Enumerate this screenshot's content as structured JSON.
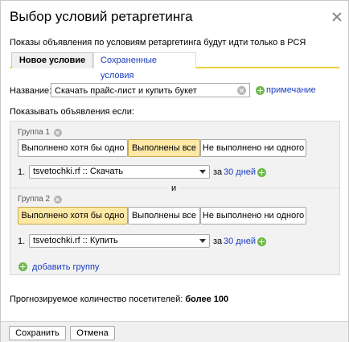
{
  "dialog": {
    "title": "Выбор условий ретаргетинга",
    "subtitle": "Показы объявления по условиям ретаргетинга будут идти только в РСЯ"
  },
  "tabs": [
    {
      "label": "Новое условие",
      "active": true
    },
    {
      "label": "Сохраненные условия",
      "active": false
    }
  ],
  "name_field": {
    "label": "Название:",
    "value": "Скачать прайс-лист и купить букет",
    "note_link": "примечание"
  },
  "show_label": "Показывать объявления если:",
  "groups": [
    {
      "label": "Группа 1",
      "options": [
        "Выполнено хотя бы одно",
        "Выполнены все",
        "Не выполнено ни одного"
      ],
      "selected": "Выполнены все",
      "condition": {
        "index": "1.",
        "goal": "tsvetochki.rf :: Скачать",
        "for_label": "за",
        "days_link": "30 дней"
      }
    },
    {
      "label": "Группа 2",
      "options": [
        "Выполнено хотя бы одно",
        "Выполнены все",
        "Не выполнено ни одного"
      ],
      "selected": "Выполнено хотя бы одно",
      "condition": {
        "index": "1.",
        "goal": "tsvetochki.rf :: Купить",
        "for_label": "за",
        "days_link": "30 дней"
      }
    }
  ],
  "and_label": "и",
  "add_group_link": "добавить группу",
  "forecast": {
    "label": "Прогнозируемое количество посетителей:",
    "value": "более 100"
  },
  "buttons": {
    "save": "Сохранить",
    "cancel": "Отмена"
  },
  "colors": {
    "accent_tab_line": "#f0ce3c",
    "selected_segment": "#fde8a6",
    "link": "#1a3dc1",
    "plus_icon": "#6bb848"
  },
  "icons": [
    "close-icon",
    "clear-icon",
    "plus-icon",
    "dropdown-arrow-icon"
  ]
}
